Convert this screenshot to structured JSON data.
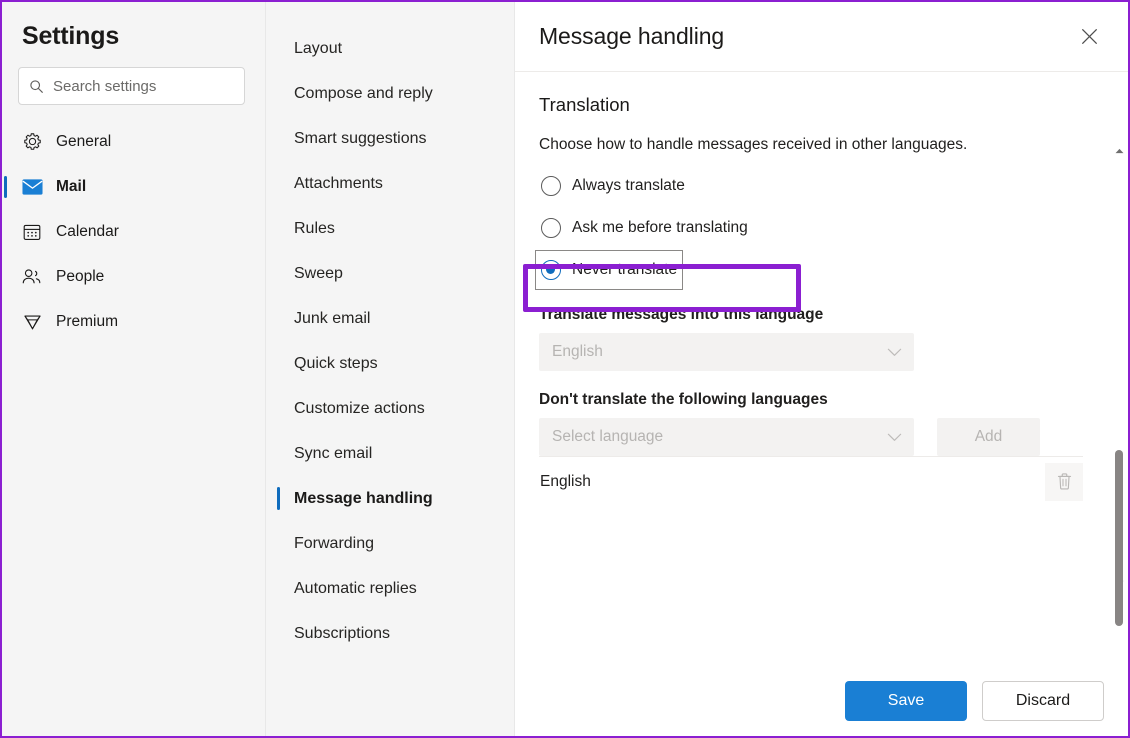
{
  "window": {
    "accent_highlight_color": "#8b1fd1",
    "selection_accent_color": "#0f6cbd"
  },
  "sidebar": {
    "title": "Settings",
    "search": {
      "placeholder": "Search settings",
      "value": "",
      "icon": "search-icon"
    },
    "items": [
      {
        "label": "General",
        "icon": "gear-icon",
        "selected": false
      },
      {
        "label": "Mail",
        "icon": "envelope-icon",
        "selected": true
      },
      {
        "label": "Calendar",
        "icon": "calendar-icon",
        "selected": false
      },
      {
        "label": "People",
        "icon": "people-icon",
        "selected": false
      },
      {
        "label": "Premium",
        "icon": "diamond-icon",
        "selected": false
      }
    ]
  },
  "subnav": {
    "items": [
      {
        "label": "Layout",
        "selected": false
      },
      {
        "label": "Compose and reply",
        "selected": false
      },
      {
        "label": "Smart suggestions",
        "selected": false
      },
      {
        "label": "Attachments",
        "selected": false
      },
      {
        "label": "Rules",
        "selected": false
      },
      {
        "label": "Sweep",
        "selected": false
      },
      {
        "label": "Junk email",
        "selected": false
      },
      {
        "label": "Quick steps",
        "selected": false
      },
      {
        "label": "Customize actions",
        "selected": false
      },
      {
        "label": "Sync email",
        "selected": false
      },
      {
        "label": "Message handling",
        "selected": true
      },
      {
        "label": "Forwarding",
        "selected": false
      },
      {
        "label": "Automatic replies",
        "selected": false
      },
      {
        "label": "Subscriptions",
        "selected": false
      }
    ]
  },
  "main": {
    "title": "Message handling",
    "close_icon": "close-icon",
    "section": {
      "heading": "Translation",
      "description": "Choose how to handle messages received in other languages."
    },
    "radios": [
      {
        "label": "Always translate",
        "checked": false,
        "focused": false,
        "highlighted": false
      },
      {
        "label": "Ask me before translating",
        "checked": false,
        "focused": false,
        "highlighted": true
      },
      {
        "label": "Never translate",
        "checked": true,
        "focused": true,
        "highlighted": false
      }
    ],
    "translate_into": {
      "label": "Translate messages into this language",
      "value": "English",
      "disabled": true,
      "chevron_icon": "chevron-down-icon"
    },
    "exclude": {
      "label": "Don't translate the following languages",
      "select_placeholder": "Select language",
      "select_value": "",
      "select_disabled": true,
      "add_label": "Add",
      "add_disabled": true,
      "chevron_icon": "chevron-down-icon",
      "languages": [
        {
          "name": "English",
          "delete_icon": "trash-icon"
        }
      ]
    },
    "scrollbar": {
      "up_icon": "scroll-up-arrow-icon",
      "down_icon": "scroll-down-arrow-icon"
    }
  },
  "footer": {
    "save_label": "Save",
    "discard_label": "Discard"
  }
}
